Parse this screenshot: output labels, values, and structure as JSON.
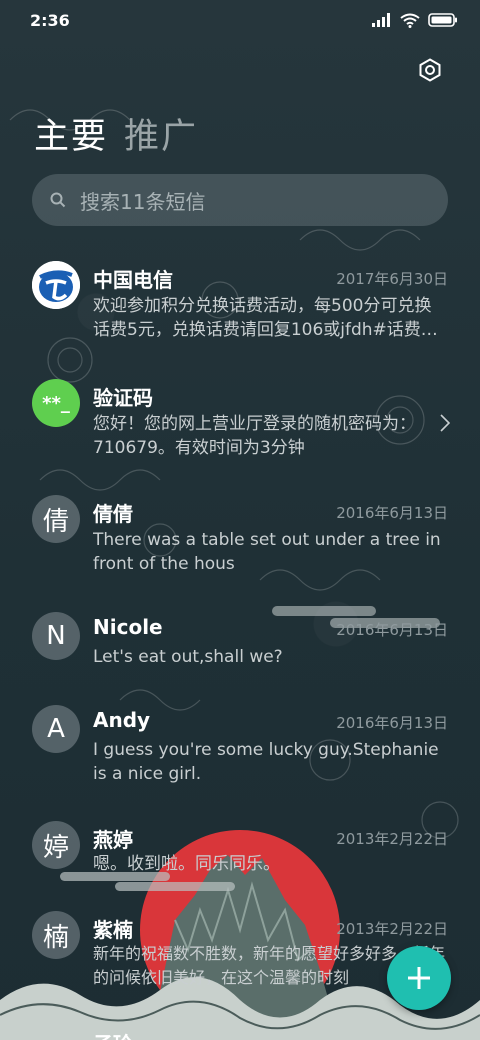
{
  "status_bar": {
    "time": "2:36"
  },
  "tabs": [
    {
      "label": "主要"
    },
    {
      "label": "推广"
    }
  ],
  "search": {
    "placeholder": "搜索11条短信"
  },
  "conversations": [
    {
      "name": "中国电信",
      "date": "2017年6月30日",
      "preview": "欢迎参加积分兑换话费活动，每500分可兑换话费5元，兑换话费请回复106或jfdh#话费…",
      "avatar": "china-telecom-logo"
    },
    {
      "name": "验证码",
      "date": "",
      "preview": "您好！您的网上营业厅登录的随机密码为：710679。有效时间为3分钟",
      "avatar_text": "**_"
    },
    {
      "name": "倩倩",
      "date": "2016年6月13日",
      "preview": "There was a table set out under a tree in front of the hous",
      "avatar_text": "倩"
    },
    {
      "name": "Nicole",
      "date": "2016年6月13日",
      "preview": "Let's eat out,shall we?",
      "avatar_text": "N"
    },
    {
      "name": "Andy",
      "date": "2016年6月13日",
      "preview": "I guess you're some lucky guy.Stephanie is a nice girl.",
      "avatar_text": "A"
    },
    {
      "name": "燕婷",
      "date": "2013年2月22日",
      "preview": "嗯。收到啦。同乐同乐。",
      "avatar_text": "婷"
    },
    {
      "name": "紫楠",
      "date": "2013年2月22日",
      "preview": "新年的祝福数不胜数，新年的愿望好多好多，新年的问候依旧美好，在这个温馨的时刻",
      "avatar_text": "楠"
    },
    {
      "name": "子玲",
      "date": "",
      "preview": "",
      "avatar_text": ""
    }
  ],
  "colors": {
    "accent": "#1fbfb0",
    "verify_avatar": "#5fcf4f",
    "sun": "#d9363a"
  }
}
